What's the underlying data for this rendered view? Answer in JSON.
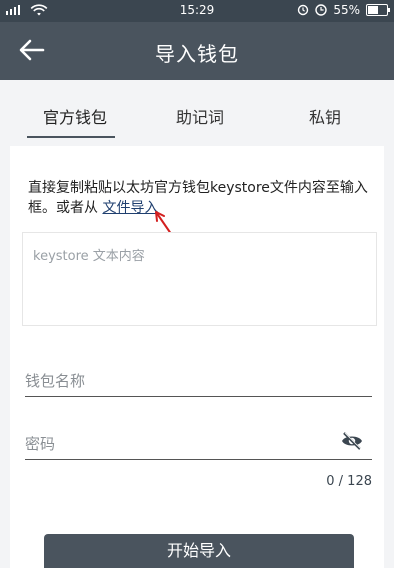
{
  "statusbar": {
    "time": "15:29",
    "battery": "55%",
    "battery_level": 0.55,
    "icons": [
      "signal-icon",
      "wifi-icon",
      "alarm-icon",
      "clock-icon",
      "battery-icon"
    ]
  },
  "appbar": {
    "title": "导入钱包",
    "back_icon": "back-arrow-icon"
  },
  "tabs": [
    {
      "label": "官方钱包"
    },
    {
      "label": "助记词"
    },
    {
      "label": "私钥"
    }
  ],
  "description": {
    "text": "直接复制粘贴以太坊官方钱包keystore文件内容至输入框。或者从 ",
    "link": "文件导入"
  },
  "keystore": {
    "placeholder": "keystore 文本内容"
  },
  "wallet_name": {
    "placeholder": "钱包名称"
  },
  "password": {
    "placeholder": "密码",
    "eye_icon": "eye-off-icon"
  },
  "counter": "0 / 128",
  "button": {
    "label": "开始导入"
  }
}
